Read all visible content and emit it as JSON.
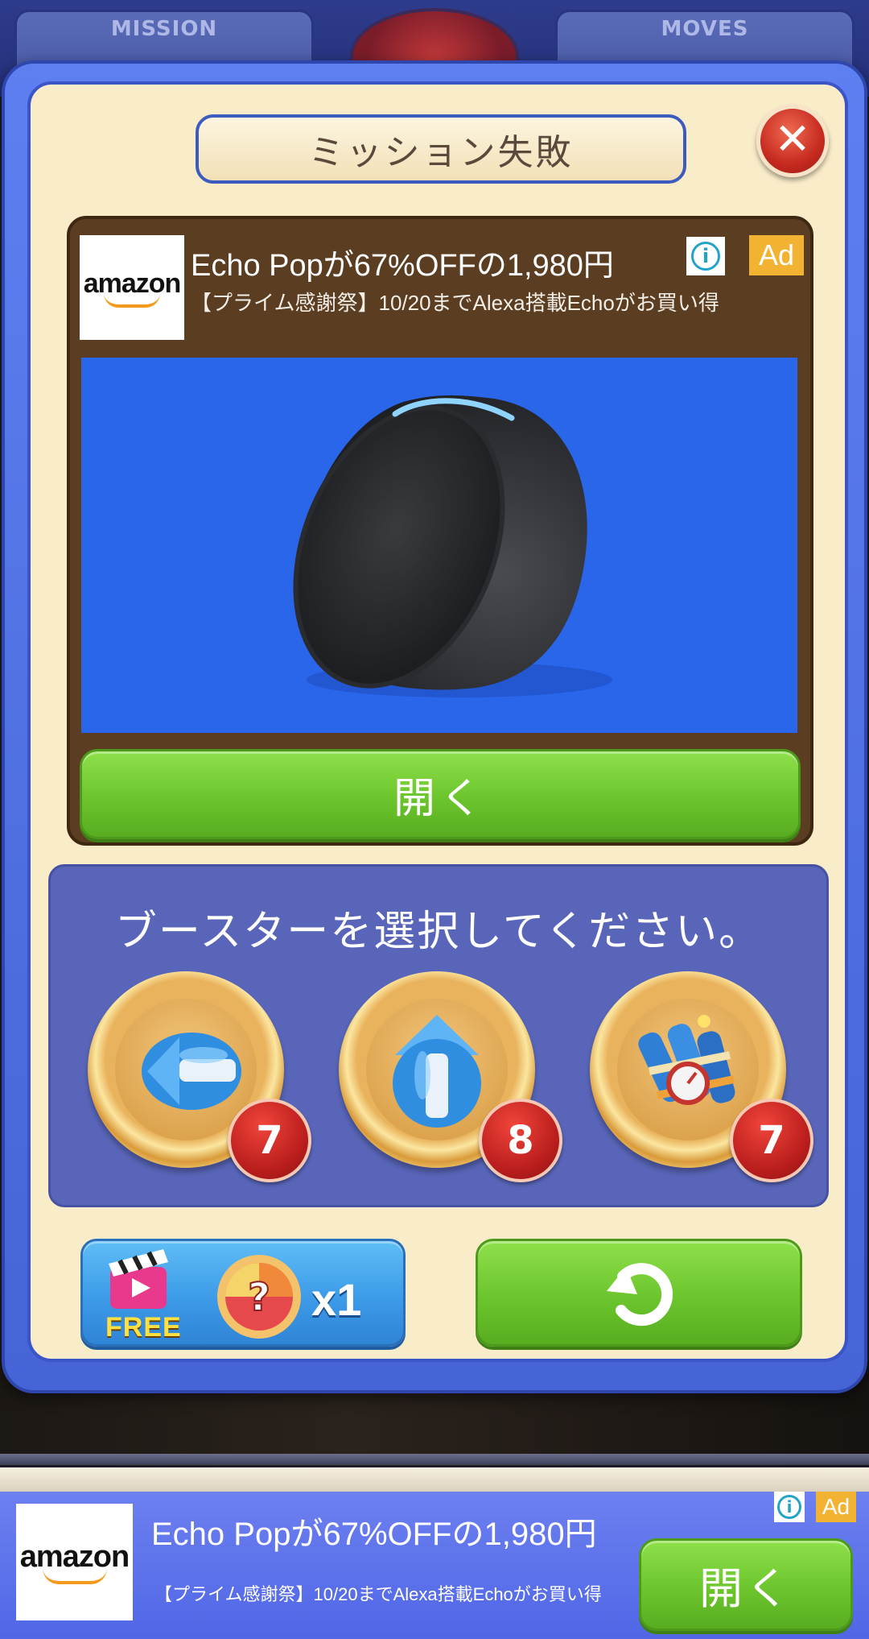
{
  "hud": {
    "mission_label": "MISSION",
    "moves_label": "MOVES"
  },
  "modal": {
    "title": "ミッション失敗",
    "close_icon": "close-icon"
  },
  "ad": {
    "advertiser_logo": "amazon",
    "title": "Echo Popが67%OFFの1,980円",
    "subtitle": "【プライム感謝祭】10/20までAlexa搭載Echoがお買い得",
    "badge": "Ad",
    "open_label": "開く",
    "accent_color": "#2a66ea"
  },
  "booster": {
    "prompt": "ブースターを選択してください。",
    "items": [
      {
        "name": "horizontal-rocket",
        "count": "7"
      },
      {
        "name": "vertical-rocket",
        "count": "8"
      },
      {
        "name": "dynamite-bomb",
        "count": "7"
      }
    ]
  },
  "actions": {
    "free_label": "FREE",
    "free_multiplier": "x1",
    "retry_icon": "retry-icon"
  },
  "banner": {
    "advertiser_logo": "amazon",
    "title": "Echo Popが67%OFFの1,980円",
    "subtitle": "【プライム感謝祭】10/20までAlexa搭載Echoがお買い得",
    "badge": "Ad",
    "open_label": "開く"
  },
  "colors": {
    "modal_blue": "#4564d6",
    "cream": "#f9ecc9",
    "green_button": "#6cc52d",
    "ad_brown": "#5b3d22"
  }
}
